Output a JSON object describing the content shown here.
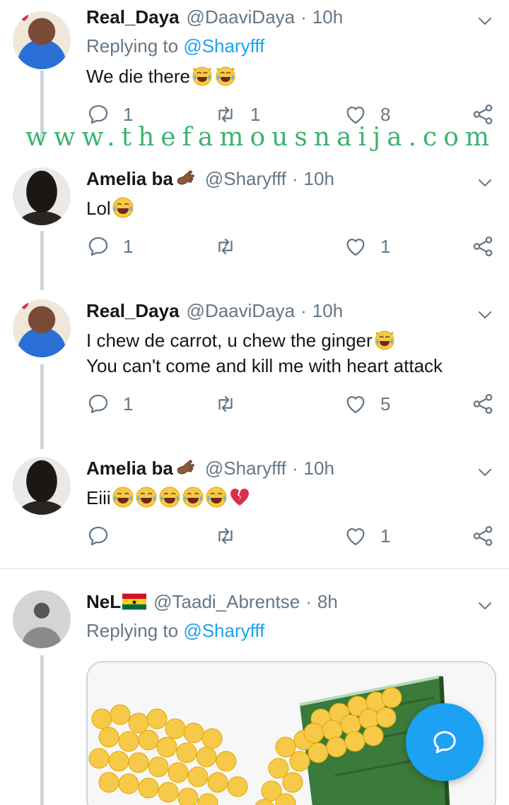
{
  "watermark": "www.thefamousnaija.com",
  "tweets": [
    {
      "name": "Real_Daya",
      "handle": "@DaaviDaya",
      "time": "10h",
      "replying_prefix": "Replying to",
      "replying_to": "@Sharyfff",
      "text": "We die there",
      "emojis": [
        "grinning-cat-tears-emoji",
        "grinning-cat-tears-emoji"
      ],
      "replies": "1",
      "retweets": "1",
      "likes": "8"
    },
    {
      "name": "Amelia ba",
      "handle": "@Sharyfff",
      "time": "10h",
      "text": "Lol",
      "emojis": [
        "tears-of-joy-emoji"
      ],
      "replies": "1",
      "retweets": "",
      "likes": "1"
    },
    {
      "name": "Real_Daya",
      "handle": "@DaaviDaya",
      "time": "10h",
      "text_line1": "I chew de carrot, u chew the ginger",
      "text_line2": "You can't come and kill me with heart attack",
      "emojis": [
        "grinning-cat-tears-emoji"
      ],
      "replies": "1",
      "retweets": "",
      "likes": "5"
    },
    {
      "name": "Amelia ba",
      "handle": "@Sharyfff",
      "time": "10h",
      "text": "Eiii",
      "emojis": [
        "tears-of-joy-emoji",
        "tears-of-joy-emoji",
        "tears-of-joy-emoji",
        "tears-of-joy-emoji",
        "tears-of-joy-emoji",
        "broken-heart-emoji"
      ],
      "replies": "",
      "retweets": "",
      "likes": "1"
    },
    {
      "name": "NeL",
      "handle": "@Taadi_Abrentse",
      "time": "8h",
      "replying_prefix": "Replying to",
      "replying_to": "@Sharyfff"
    }
  ],
  "colors": {
    "accent": "#1da1f2",
    "muted": "#657786",
    "thread_line": "#ccd6dd",
    "watermark": "#3cb371"
  },
  "fab_icon": "compose-reply-icon"
}
